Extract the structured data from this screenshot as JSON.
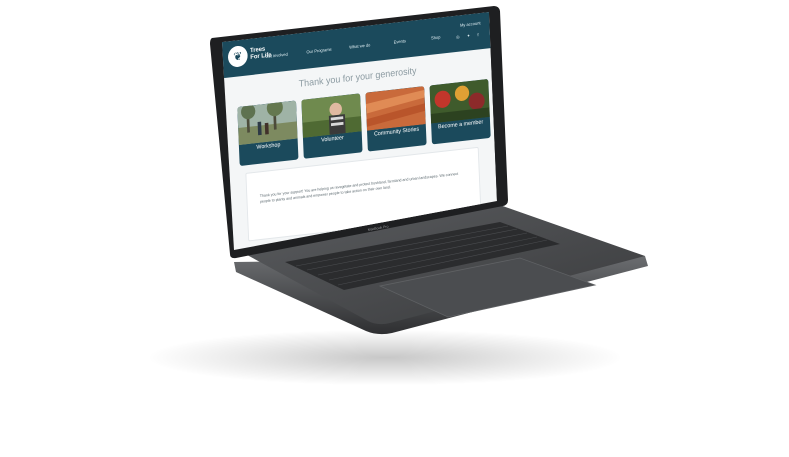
{
  "site": {
    "logo_name": "Trees",
    "logo_sub": "For Life",
    "logo_icon": "leaf-icon"
  },
  "nav": {
    "items": [
      "Get involved",
      "Our Programs",
      "What we do",
      "Events",
      "Shop"
    ],
    "account": "My account",
    "social": [
      "instagram-icon",
      "twitter-icon",
      "facebook-icon"
    ]
  },
  "page": {
    "title": "Thank you for your generosity"
  },
  "cards": [
    {
      "label": "Workshop"
    },
    {
      "label": "Volunteer"
    },
    {
      "label": "Community Stories"
    },
    {
      "label": "Become a member"
    }
  ],
  "panel": {
    "text": "Thank you for your support! You are helping us revegetate and protect bushland, farmland and urban landscapes. We connect people to plants and animals and empower people to take action on their own land."
  },
  "device": {
    "brand": "MacBook Pro"
  },
  "colors": {
    "nav": "#1b4a5c",
    "body_gray": "#3b3c3e",
    "card": "#1b4a5c"
  }
}
